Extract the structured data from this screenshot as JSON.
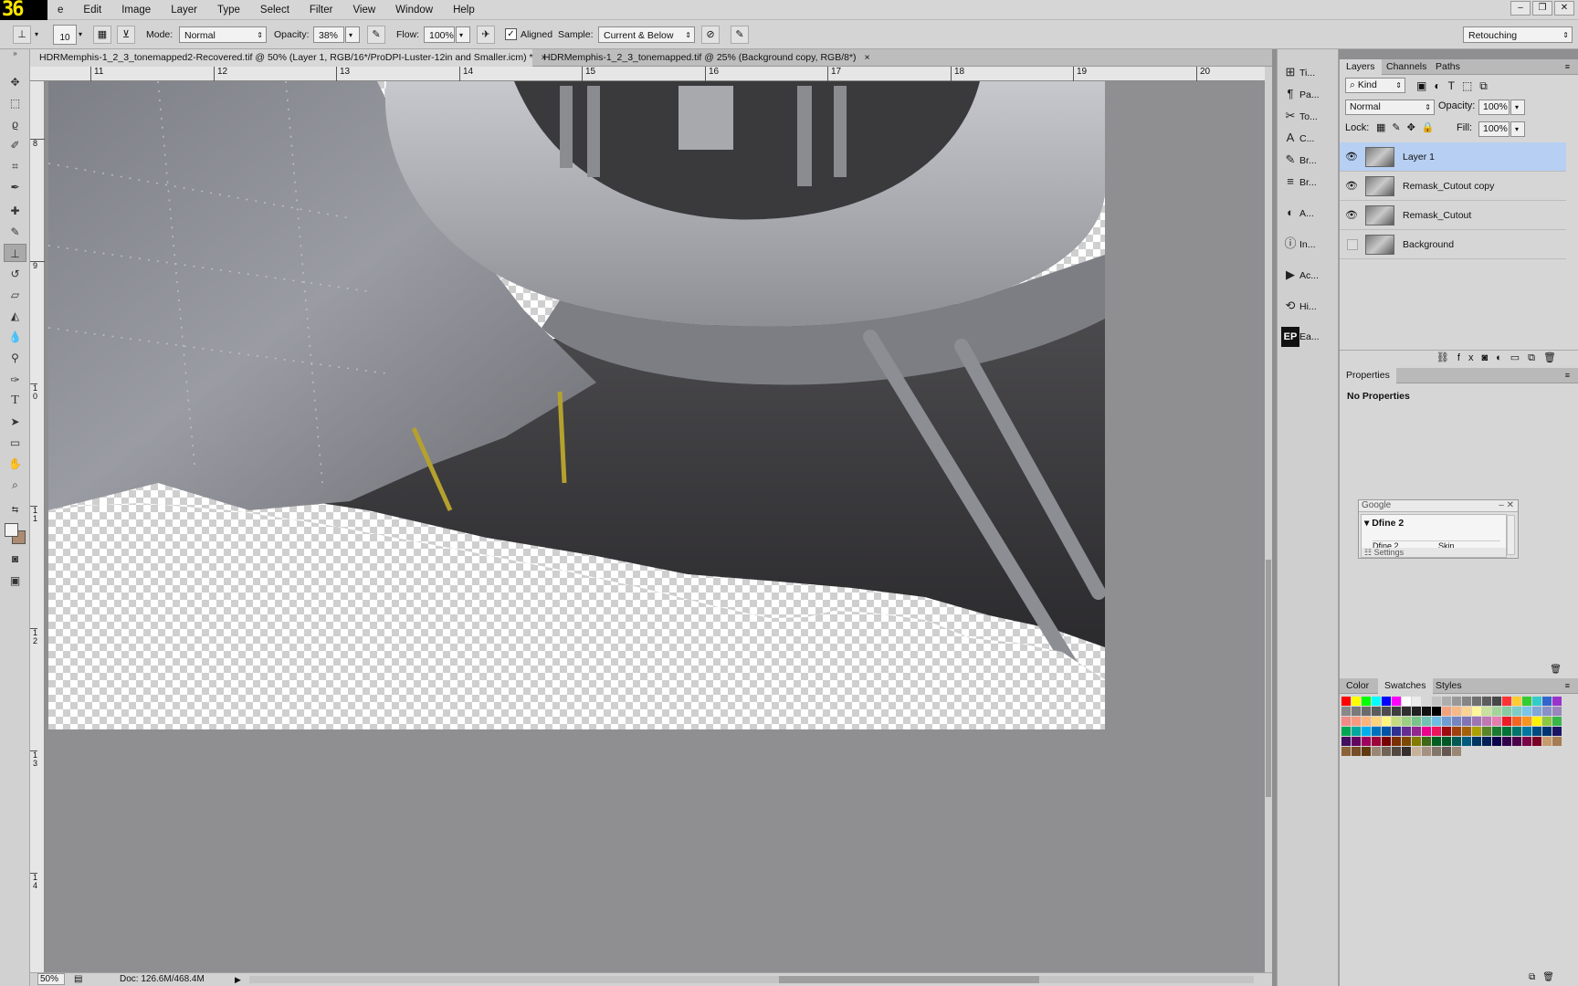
{
  "menubar": {
    "logo": "36",
    "items": [
      "e",
      "Edit",
      "Image",
      "Layer",
      "Type",
      "Select",
      "Filter",
      "View",
      "Window",
      "Help"
    ],
    "window_controls": [
      "–",
      "❐",
      "✕"
    ]
  },
  "options": {
    "brush_size": "10",
    "mode_label": "Mode:",
    "mode_value": "Normal",
    "opacity_label": "Opacity:",
    "opacity_value": "38%",
    "flow_label": "Flow:",
    "flow_value": "100%",
    "aligned_label": "Aligned",
    "sample_label": "Sample:",
    "sample_value": "Current & Below",
    "workspace": "Retouching"
  },
  "tabs": [
    {
      "label": "HDRMemphis-1_2_3_tonemapped2-Recovered.tif @ 50% (Layer 1, RGB/16*/ProDPI-Luster-12in and Smaller.icm) *",
      "close": "×"
    },
    {
      "label": "HDRMemphis-1_2_3_tonemapped.tif @ 25% (Background copy, RGB/8*)",
      "close": "×"
    }
  ],
  "hruler_ticks": [
    "11",
    "12",
    "13",
    "14",
    "15",
    "16",
    "17",
    "18",
    "19",
    "20"
  ],
  "vruler_ticks": [
    "8",
    "9",
    "1 0",
    "1 1",
    "1 2",
    "1 3",
    "1 4"
  ],
  "status": {
    "zoom": "50%",
    "doc": "Doc: 126.6M/468.4M"
  },
  "iconstrip": [
    {
      "icon": "timeline-icon",
      "glyph": "⊞",
      "label": "Ti..."
    },
    {
      "icon": "paragraph-icon",
      "glyph": "¶",
      "label": "Pa..."
    },
    {
      "icon": "tool-presets-icon",
      "glyph": "✂",
      "label": "To..."
    },
    {
      "icon": "character-icon",
      "glyph": "A",
      "label": "C..."
    },
    {
      "icon": "brush-icon",
      "glyph": "✎",
      "label": "Br..."
    },
    {
      "icon": "brush-presets-icon",
      "glyph": "≡",
      "label": "Br..."
    },
    {
      "icon": "adjustments-icon",
      "glyph": "◐",
      "label": "A..."
    },
    {
      "icon": "info-icon",
      "glyph": "ⓘ",
      "label": "In..."
    },
    {
      "icon": "actions-icon",
      "glyph": "▶",
      "label": "Ac..."
    },
    {
      "icon": "history-icon",
      "glyph": "⟲",
      "label": "Hi..."
    },
    {
      "icon": "ep-icon",
      "glyph": "EP",
      "label": "Ea..."
    }
  ],
  "layers_panel": {
    "tabs": [
      "Layers",
      "Channels",
      "Paths"
    ],
    "kind": "Kind",
    "blend": "Normal",
    "opacity_label": "Opacity:",
    "opacity_value": "100%",
    "lock_label": "Lock:",
    "fill_label": "Fill:",
    "fill_value": "100%",
    "layers": [
      {
        "name": "Layer 1",
        "visible": true,
        "selected": true
      },
      {
        "name": "Remask_Cutout copy",
        "visible": true,
        "selected": false
      },
      {
        "name": "Remask_Cutout",
        "visible": true,
        "selected": false
      },
      {
        "name": "Background",
        "visible": false,
        "selected": false
      }
    ]
  },
  "properties_panel": {
    "tab": "Properties",
    "text": "No Properties"
  },
  "google_panel": {
    "title": "Google",
    "plugin": "Dfine 2",
    "col1": "Dfine 2",
    "col2": "Skin",
    "settings": "Settings"
  },
  "swatches_panel": {
    "tabs": [
      "Color",
      "Swatches",
      "Styles"
    ],
    "rows": [
      [
        "#ff0000",
        "#ffff00",
        "#00ff00",
        "#00ffff",
        "#0000ff",
        "#ff00ff",
        "#ffffff",
        "#ebebeb",
        "#d6d6d6",
        "#c2c2c2",
        "#adadad",
        "#999999",
        "#858585",
        "#707070",
        "#5c5c5c",
        "#474747",
        "#ff3333",
        "#ffcc33",
        "#33cc33",
        "#33cccc",
        "#3366cc",
        "#9933cc"
      ],
      [
        "#888888",
        "#7a7a7a",
        "#6b6b6b",
        "#5c5c5c",
        "#4d4d4d",
        "#3e3e3e",
        "#2f2f2f",
        "#202020",
        "#111111",
        "#000000",
        "#f2a37e",
        "#f7b98a",
        "#fbd392",
        "#fff59a",
        "#c9e19a",
        "#a5d49b",
        "#86cba1",
        "#7dcdc6",
        "#78c6e9",
        "#7fa7d8",
        "#8891c8",
        "#9a86bd"
      ],
      [
        "#f28a87",
        "#f59a7f",
        "#fab37c",
        "#fdd37d",
        "#fff57e",
        "#c4dc7f",
        "#9ccf81",
        "#79c48a",
        "#6fc4b4",
        "#6cbde4",
        "#6f9cd2",
        "#7485c1",
        "#8274b4",
        "#9e74b3",
        "#c077b3",
        "#e57eac",
        "#ed1c24",
        "#f26522",
        "#f7941d",
        "#fff200",
        "#8dc63f",
        "#39b54a"
      ],
      [
        "#00a651",
        "#00a99d",
        "#00aeef",
        "#0072bc",
        "#0054a6",
        "#2e3192",
        "#662d91",
        "#92278f",
        "#ec008c",
        "#ed145b",
        "#9e0b0f",
        "#a0410d",
        "#a36209",
        "#aba000",
        "#598527",
        "#1a7b30",
        "#007236",
        "#00746b",
        "#0076a3",
        "#004b80",
        "#003471",
        "#1b1464"
      ],
      [
        "#440e62",
        "#630460",
        "#9e005d",
        "#9e0039",
        "#790000",
        "#7b2e00",
        "#7d4900",
        "#827b00",
        "#406618",
        "#005e20",
        "#005826",
        "#005952",
        "#005b7f",
        "#003663",
        "#002157",
        "#0d004c",
        "#32004b",
        "#4b0049",
        "#7b0046",
        "#7a0026",
        "#c69c6d",
        "#a67c52"
      ],
      [
        "#8c6239",
        "#754c24",
        "#603913",
        "#998675",
        "#736357",
        "#534741",
        "#362f2d",
        "#c7b299",
        "#a49181",
        "#83756a",
        "#645850",
        "#998675"
      ]
    ]
  }
}
